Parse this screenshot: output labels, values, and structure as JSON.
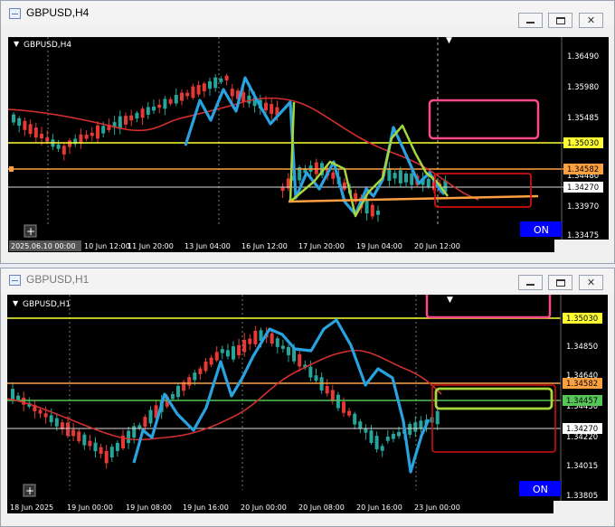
{
  "top_window": {
    "title": "GBPUSD,H4",
    "chart_label": "GBPUSD,H4",
    "price_ticks": [
      "1.36490",
      "1.35980",
      "1.35485",
      "1.34480",
      "1.33970",
      "1.33475"
    ],
    "price_markers": {
      "yellow": "1.35030",
      "orange": "1.34582",
      "white": "1.34270"
    },
    "time_labels": [
      "2025.06.10 00:00",
      "10 Jun 12:00",
      "11 Jun 20:00",
      "13 Jun 04:00",
      "16 Jun 12:00",
      "17 Jun 20:00",
      "19 Jun 04:00",
      "20 Jun 12:00"
    ],
    "on_badge": "ON",
    "plus_icon": "+"
  },
  "bottom_window": {
    "title": "GBPUSD,H1",
    "chart_label": "GBPUSD,H1",
    "price_ticks": [
      "1.34850",
      "1.34640",
      "1.34430",
      "1.34220",
      "1.34015",
      "1.33805"
    ],
    "price_markers": {
      "yellow": "1.35030",
      "orange": "1.34582",
      "green": "1.34457",
      "white": "1.34270"
    },
    "time_labels": [
      "18 Jun 2025",
      "19 Jun 00:00",
      "19 Jun 08:00",
      "19 Jun 16:00",
      "20 Jun 00:00",
      "20 Jun 08:00",
      "20 Jun 16:00",
      "23 Jun 00:00"
    ],
    "on_badge": "ON",
    "plus_icon": "+"
  },
  "colors": {
    "bull": "#26a69a",
    "bear": "#e53935",
    "ma": "#d32f2f",
    "zigzag": "#29a3e0",
    "yellow_line": "#ffff33",
    "orange_line": "#ffa040",
    "green_line": "#55c555",
    "pink_box": "#ff4a8a",
    "on_badge": "#0000ff"
  }
}
